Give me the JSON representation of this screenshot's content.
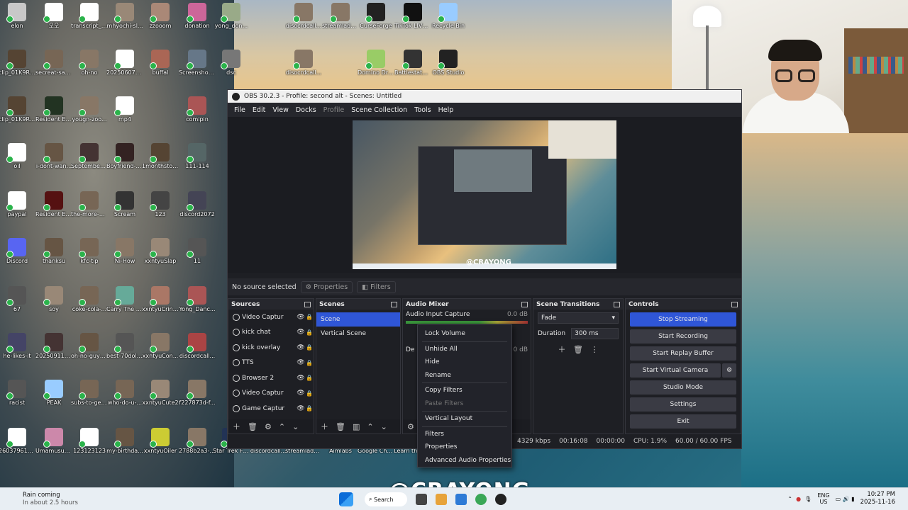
{
  "desktop": {
    "icons": [
      {
        "label": "elon",
        "c": "#c8c8c8"
      },
      {
        "label": "오오",
        "c": "#ffffff"
      },
      {
        "label": "transcript_S...",
        "c": "#ffffff"
      },
      {
        "label": "mhyochi-sl...",
        "c": "#998877"
      },
      {
        "label": "zzooom",
        "c": "#aa8877"
      },
      {
        "label": "donation",
        "c": "#c69"
      },
      {
        "label": "yong_don...",
        "c": "#9a8"
      },
      {
        "label": "clip_01K9RX...",
        "c": "#543"
      },
      {
        "label": "secreat-sauce",
        "c": "#765"
      },
      {
        "label": "oh-no",
        "c": "#876"
      },
      {
        "label": "20250607_5...",
        "c": "#fff"
      },
      {
        "label": "buffal",
        "c": "#a65"
      },
      {
        "label": "Screenshot...",
        "c": "#678"
      },
      {
        "label": "dsc",
        "c": "#777"
      },
      {
        "label": "clip_01K9RT...",
        "c": "#543"
      },
      {
        "label": "Resident Evil 4",
        "c": "#232"
      },
      {
        "label": "yougn-zoo...",
        "c": "#876"
      },
      {
        "label": "mp4",
        "c": "#fff"
      },
      {
        "label": "comipin",
        "c": "#a55"
      },
      {
        "label": "oil",
        "c": "#fff"
      },
      {
        "label": "i-dont-wan...",
        "c": "#654"
      },
      {
        "label": "September 7th",
        "c": "#433"
      },
      {
        "label": "Boyfriend-g...",
        "c": "#322"
      },
      {
        "label": "1monthstob...",
        "c": "#543"
      },
      {
        "label": "111-114",
        "c": "#566"
      },
      {
        "label": "paypal",
        "c": "#fff"
      },
      {
        "label": "Resident Evil Revelations 2",
        "c": "#511"
      },
      {
        "label": "the-more-o...",
        "c": "#765"
      },
      {
        "label": "Scream",
        "c": "#333"
      },
      {
        "label": "123",
        "c": "#444"
      },
      {
        "label": "discord2072",
        "c": "#445"
      },
      {
        "label": "Discord",
        "c": "#5865f2"
      },
      {
        "label": "thanksu",
        "c": "#654"
      },
      {
        "label": "kfc-tip",
        "c": "#765"
      },
      {
        "label": "Ni-How",
        "c": "#876"
      },
      {
        "label": "xxntyuSlap",
        "c": "#987"
      },
      {
        "label": "11",
        "c": "#555"
      },
      {
        "label": "67",
        "c": "#555"
      },
      {
        "label": "soy",
        "c": "#987"
      },
      {
        "label": "coke-cola-...",
        "c": "#765"
      },
      {
        "label": "Carry The Glass",
        "c": "#6a9"
      },
      {
        "label": "xxntyuCringe",
        "c": "#a76"
      },
      {
        "label": "Yong_Danc...",
        "c": "#a55"
      },
      {
        "label": "he-likes-it",
        "c": "#446"
      },
      {
        "label": "20250911_E...",
        "c": "#433"
      },
      {
        "label": "oh-no-guys...",
        "c": "#654"
      },
      {
        "label": "best-70doll...",
        "c": "#555"
      },
      {
        "label": "xxntyuCon...",
        "c": "#876"
      },
      {
        "label": "discordcall...",
        "c": "#a44"
      },
      {
        "label": "racist",
        "c": "#555"
      },
      {
        "label": "PEAK",
        "c": "#9cf"
      },
      {
        "label": "subs-to-get...",
        "c": "#765"
      },
      {
        "label": "who-do-u-...",
        "c": "#765"
      },
      {
        "label": "xxntyuCute2",
        "c": "#987"
      },
      {
        "label": "f227873d-f...",
        "c": "#876"
      },
      {
        "label": "2603796138... (1)",
        "c": "#fff"
      },
      {
        "label": "Umamusume Pretty Derby",
        "c": "#c8a"
      },
      {
        "label": "123123123",
        "c": "#fff"
      },
      {
        "label": "my-birthda...",
        "c": "#654"
      },
      {
        "label": "xxntyuOiler",
        "c": "#cc3"
      },
      {
        "label": "2788b2a3-9...",
        "c": "#876"
      },
      {
        "label": "disocrdcall...",
        "c": "#876"
      },
      {
        "label": "streamladd... always pay...",
        "c": "#876"
      },
      {
        "label": "CurseForge",
        "c": "#222"
      },
      {
        "label": "TikTok LIVE Studio",
        "c": "#111"
      },
      {
        "label": "Recycle Bin",
        "c": "#9cf"
      },
      {
        "label": "disocrdcall...",
        "c": "#876"
      },
      {
        "label": "Domino Dreams pa...",
        "c": "#9c6"
      },
      {
        "label": "Battlestate Games L...",
        "c": "#333"
      },
      {
        "label": "OBS Studio",
        "c": "#222"
      },
      {
        "label": "Star Trek Fleet Com...",
        "c": "#235"
      },
      {
        "label": "discordcall...",
        "c": "#876"
      },
      {
        "label": "streamladd... not",
        "c": "#876"
      },
      {
        "label": "Aimlabs",
        "c": "#a33"
      },
      {
        "label": "Google Chrome",
        "c": "#ddd"
      },
      {
        "label": "Learn this ...",
        "c": "#336"
      }
    ]
  },
  "obs": {
    "title": "OBS 30.2.3 - Profile: second alt - Scenes: Untitled",
    "menu": [
      "File",
      "Edit",
      "View",
      "Docks",
      "Profile",
      "Scene Collection",
      "Tools",
      "Help"
    ],
    "no_source": "No source selected",
    "properties": "Properties",
    "filters": "Filters",
    "sources": {
      "title": "Sources",
      "items": [
        "Video Captur",
        "kick chat",
        "kick overlay",
        "TTS",
        "Browser 2",
        "Video Captur",
        "Game Captur"
      ]
    },
    "scenes": {
      "title": "Scenes",
      "items": [
        "Scene",
        "Vertical Scene"
      ]
    },
    "mixer": {
      "title": "Audio Mixer",
      "channel": "Audio Input Capture",
      "db": "0.0 dB",
      "db2": "0 dB",
      "label2": "De"
    },
    "transitions": {
      "title": "Scene Transitions",
      "type": "Fade",
      "duration_label": "Duration",
      "duration_value": "300 ms"
    },
    "controls": {
      "title": "Controls",
      "buttons": [
        "Stop Streaming",
        "Start Recording",
        "Start Replay Buffer",
        "Start Virtual Camera",
        "Studio Mode",
        "Settings",
        "Exit"
      ]
    },
    "status": {
      "bitrate": "4329 kbps",
      "stream_time": "00:16:08",
      "rec_time": "00:00:00",
      "cpu": "CPU: 1.9%",
      "fps": "60.00 / 60.00 FPS"
    },
    "context_menu": {
      "items": [
        "Lock Volume",
        "Unhide All",
        "Hide",
        "Rename",
        "Copy Filters",
        "Paste Filters",
        "Vertical Layout",
        "Filters",
        "Properties",
        "Advanced Audio Properties"
      ]
    },
    "preview_watermark": "@CRAYONG"
  },
  "watermark": "@CRAYONG",
  "taskbar": {
    "weather_title": "Rain coming",
    "weather_sub": "In about 2.5 hours",
    "search": "Search",
    "lang_1": "ENG",
    "lang_2": "US",
    "time": "10:27 PM",
    "date": "2025-11-16"
  }
}
